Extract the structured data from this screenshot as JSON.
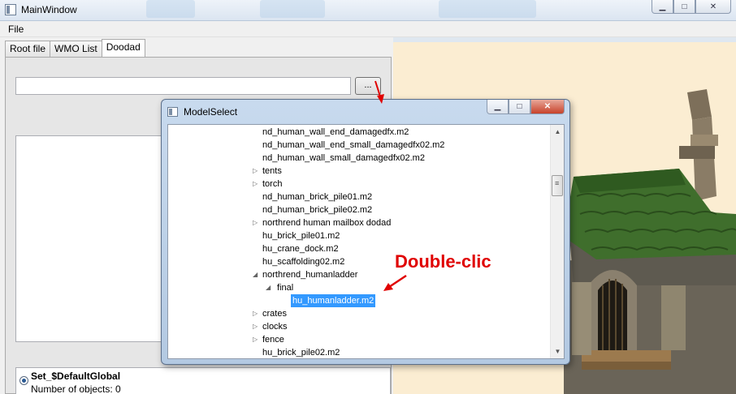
{
  "window": {
    "title": "MainWindow",
    "min_icon": "minimize-icon",
    "max_icon": "maximize-icon",
    "close_icon": "close-icon"
  },
  "menu": {
    "file": "File"
  },
  "tabs": [
    {
      "label": "Root file"
    },
    {
      "label": "WMO List"
    },
    {
      "label": "Doodad"
    }
  ],
  "doodad": {
    "path_value": "",
    "browse_label": "...",
    "set_name": "Set_$DefaultGlobal",
    "set_count": "Number of objects: 0"
  },
  "dialog": {
    "title": "ModelSelect",
    "items": [
      {
        "label": "nd_human_wall_end_damagedfx.m2",
        "expander": ""
      },
      {
        "label": "nd_human_wall_end_small_damagedfx02.m2",
        "expander": ""
      },
      {
        "label": "nd_human_wall_small_damagedfx02.m2",
        "expander": ""
      },
      {
        "label": "tents",
        "expander": "▷"
      },
      {
        "label": "torch",
        "expander": "▷"
      },
      {
        "label": "nd_human_brick_pile01.m2",
        "expander": ""
      },
      {
        "label": "nd_human_brick_pile02.m2",
        "expander": ""
      },
      {
        "label": "northrend human mailbox dodad",
        "expander": "▷"
      },
      {
        "label": "hu_brick_pile01.m2",
        "expander": ""
      },
      {
        "label": "hu_crane_dock.m2",
        "expander": ""
      },
      {
        "label": "hu_scaffolding02.m2",
        "expander": ""
      },
      {
        "label": "northrend_humanladder",
        "expander": "◢"
      },
      {
        "label": "final",
        "expander": "◢"
      },
      {
        "label": "hu_humanladder.m2",
        "expander": "",
        "selected": true
      },
      {
        "label": "crates",
        "expander": "▷"
      },
      {
        "label": "clocks",
        "expander": "▷"
      },
      {
        "label": "fence",
        "expander": "▷"
      },
      {
        "label": "hu_brick_pile02.m2",
        "expander": ""
      }
    ]
  },
  "annotation": {
    "text": "Double-clic",
    "color": "#e00000"
  },
  "colors": {
    "selection": "#3399ff",
    "viewport_bg": "#fbedd2",
    "annotation": "#e00000"
  }
}
